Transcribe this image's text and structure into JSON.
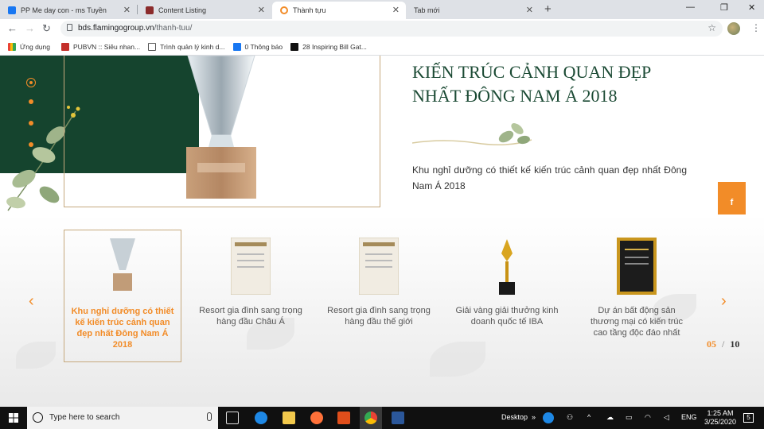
{
  "browser": {
    "tabs": [
      {
        "title": "PP Me day con - ms Tuyền",
        "active": false
      },
      {
        "title": "Content Listing",
        "active": false
      },
      {
        "title": "Thành tựu",
        "active": true
      },
      {
        "title": "Tab mới",
        "active": false
      }
    ],
    "url_domain": "bds.flamingogroup.vn",
    "url_path": "/thanh-tuu/",
    "bookmarks": [
      "Ứng dụng",
      "PUBVN :: Siêu nhan...",
      "Trình quản lý kinh d...",
      "0 Thông báo",
      "28 Inspiring Bill Gat..."
    ]
  },
  "hero": {
    "title": "KIẾN TRÚC CẢNH QUAN ĐẸP NHẤT ĐÔNG NAM Á 2018",
    "description": "Khu nghỉ dưỡng có thiết kế kiến trúc cảnh quan đẹp nhất Đông Nam Á 2018"
  },
  "awards": [
    {
      "caption": "Khu nghỉ dưỡng có thiết kế kiến trúc cảnh quan đẹp nhất Đông Nam Á 2018",
      "active": true
    },
    {
      "caption": "Resort gia đình sang trọng hàng đầu Châu Á",
      "active": false
    },
    {
      "caption": "Resort gia đình sang trọng hàng đầu thế giới",
      "active": false
    },
    {
      "caption": "Giải vàng giải thưởng kinh doanh quốc tế IBA",
      "active": false
    },
    {
      "caption": "Dự án bất động sản thương mại có kiến trúc cao tầng độc đáo nhất",
      "active": false
    }
  ],
  "pager": {
    "current": "05",
    "separator": "/",
    "total": "10"
  },
  "social_icons": [
    "facebook-icon",
    "email-icon",
    "phone-icon"
  ],
  "taskbar": {
    "search_placeholder": "Type here to search",
    "desktop_label": "Desktop",
    "lang": "ENG",
    "time": "1:25 AM",
    "date": "3/25/2020",
    "notification_count": "5"
  },
  "colors": {
    "accent": "#f28c28",
    "brand_green": "#15442e",
    "gold_border": "#c6a97e"
  }
}
